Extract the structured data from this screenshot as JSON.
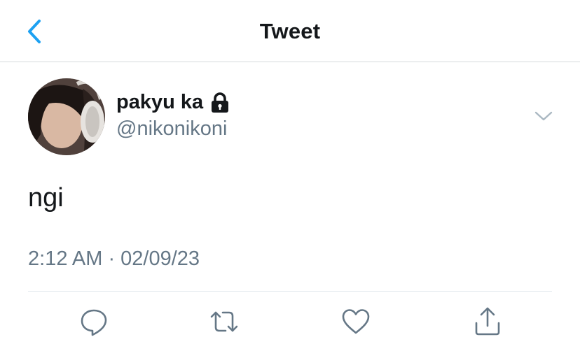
{
  "nav": {
    "title": "Tweet",
    "back_icon": "chevron-left-icon"
  },
  "tweet": {
    "author": {
      "display_name": "pakyu ka",
      "handle": "@nikonikoni",
      "protected_icon": "lock-icon"
    },
    "text": "ngi",
    "timestamp": "2:12 AM · 02/09/23"
  },
  "actions": [
    {
      "name": "reply",
      "icon": "comment-icon"
    },
    {
      "name": "retweet",
      "icon": "retweet-icon"
    },
    {
      "name": "like",
      "icon": "heart-icon"
    },
    {
      "name": "share",
      "icon": "share-icon"
    }
  ],
  "colors": {
    "accent": "#1da1f2",
    "text_primary": "#14171a",
    "text_secondary": "#657786",
    "divider": "#e1e8ed"
  }
}
